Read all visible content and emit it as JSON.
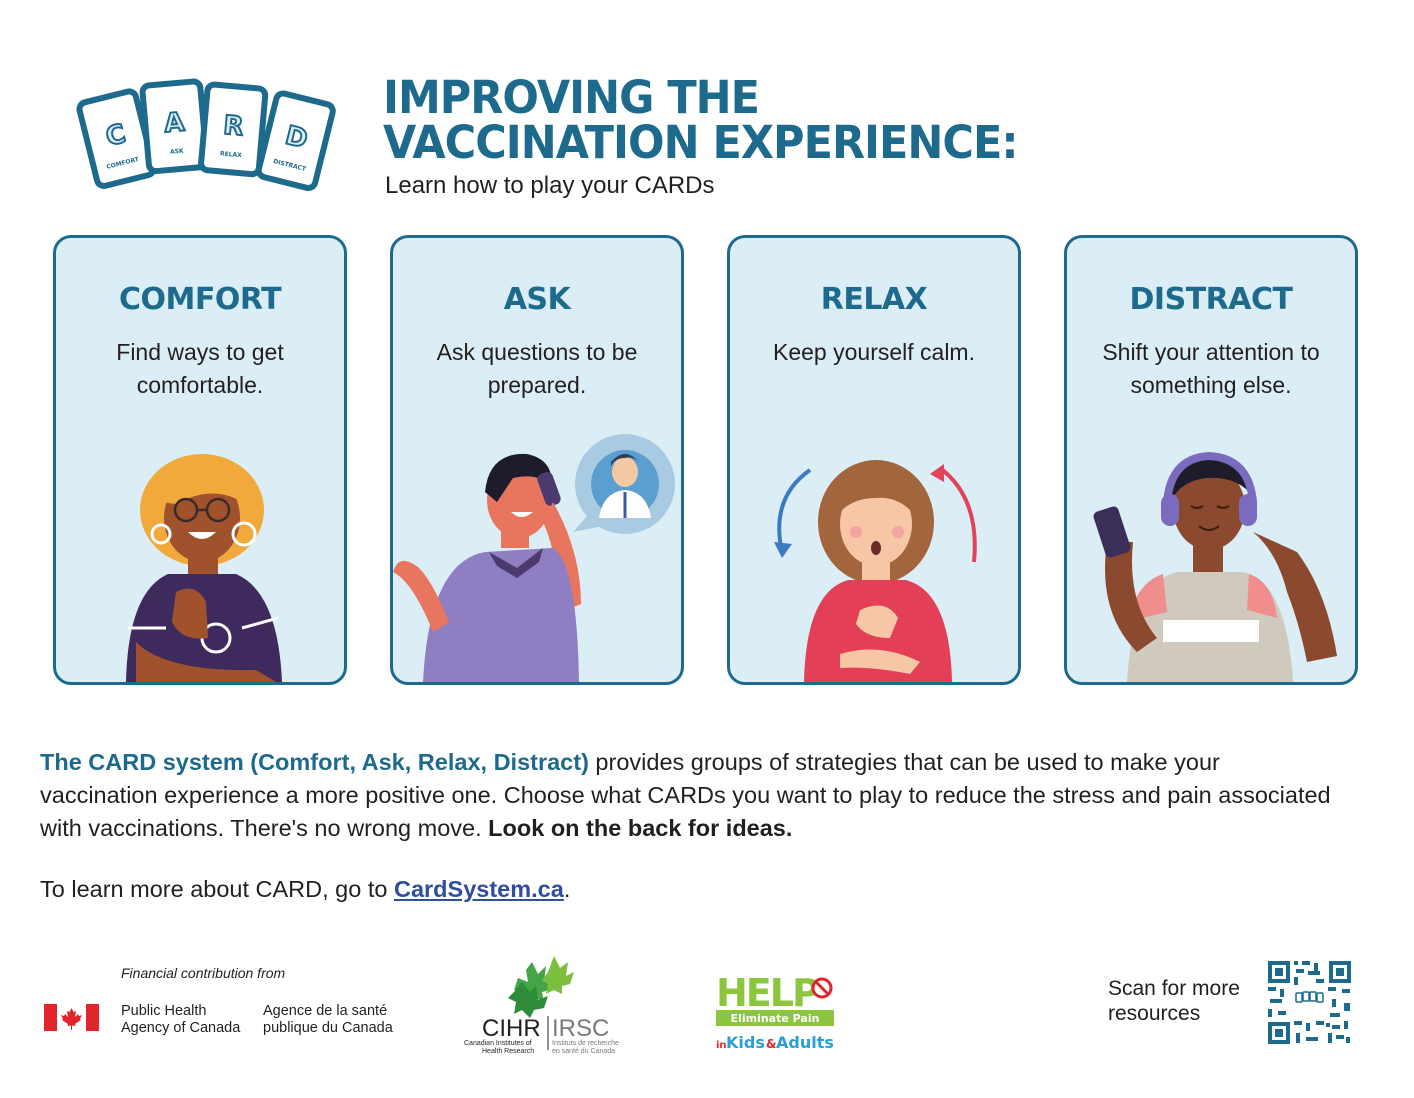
{
  "logo": {
    "cards": [
      {
        "letter": "C",
        "word": "COMFORT"
      },
      {
        "letter": "A",
        "word": "ASK"
      },
      {
        "letter": "R",
        "word": "RELAX"
      },
      {
        "letter": "D",
        "word": "DISTRACT"
      }
    ]
  },
  "header": {
    "title_line1": "IMPROVING THE",
    "title_line2": "VACCINATION EXPERIENCE:",
    "subtitle": "Learn how to play your CARDs"
  },
  "cards": [
    {
      "title": "COMFORT",
      "text": "Find ways to get comfortable."
    },
    {
      "title": "ASK",
      "text": "Ask questions to be prepared."
    },
    {
      "title": "RELAX",
      "text": "Keep yourself calm."
    },
    {
      "title": "DISTRACT",
      "text": "Shift your attention to something else."
    }
  ],
  "body": {
    "highlight": "The CARD system (Comfort, Ask, Relax, Distract)",
    "text": " provides groups of strategies that can be used to make your vaccination experience a more positive one. Choose what CARDs you want to play to reduce the stress and pain associated with vaccinations. There's no wrong move. ",
    "bold_end": "Look on the back for ideas.",
    "learn_prefix": "To learn more about CARD, go to ",
    "learn_link": "CardSystem.ca",
    "learn_suffix": "."
  },
  "footer": {
    "financial_label": "Financial contribution from",
    "phac_en_1": "Public Health",
    "phac_en_2": "Agency of Canada",
    "phac_fr_1": "Agence de la santé",
    "phac_fr_2": "publique du Canada",
    "cihr_abbr": "CIHR",
    "irsc_abbr": "IRSC",
    "cihr_name_1": "Canadian Institutes of",
    "cihr_name_2": "Health Research",
    "irsc_name_1": "Instituts de recherche",
    "irsc_name_2": "en santé du Canada",
    "help_word": "HELP",
    "help_sub": "Eliminate Pain",
    "help_in": "in",
    "help_kids": "Kids",
    "help_amp": "&",
    "help_adults": "Adults",
    "scan_line1": "Scan for more",
    "scan_line2": "resources"
  },
  "colors": {
    "brand_blue": "#1e6a8d",
    "card_bg": "#dbeef6",
    "link_blue": "#2f4f9e",
    "flag_red": "#e0262b",
    "help_green": "#8cc63f"
  }
}
